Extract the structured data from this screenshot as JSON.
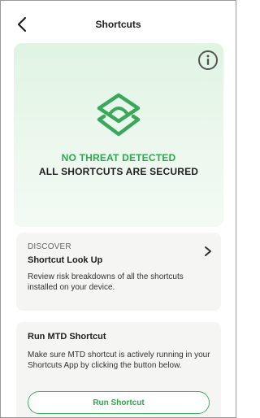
{
  "header": {
    "title": "Shortcuts",
    "back_icon": "chevron-left-icon"
  },
  "hero": {
    "info_icon": "info-icon",
    "logo_icon": "layers-shield-icon",
    "status_line1": "NO THREAT DETECTED",
    "status_line2": "ALL SHORTCUTS ARE SECURED",
    "accent_color": "#2ea84f"
  },
  "discover_card": {
    "kicker": "DISCOVER",
    "title": "Shortcut Look Up",
    "description": "Review risk breakdowns of all the shortcuts installed on your device.",
    "chevron_icon": "chevron-right-icon"
  },
  "mtd_card": {
    "title": "Run MTD Shortcut",
    "description": "Make sure MTD shortcut is actively running in your Shortcuts App by clicking the button below.",
    "button_label": "Run Shortcut"
  }
}
